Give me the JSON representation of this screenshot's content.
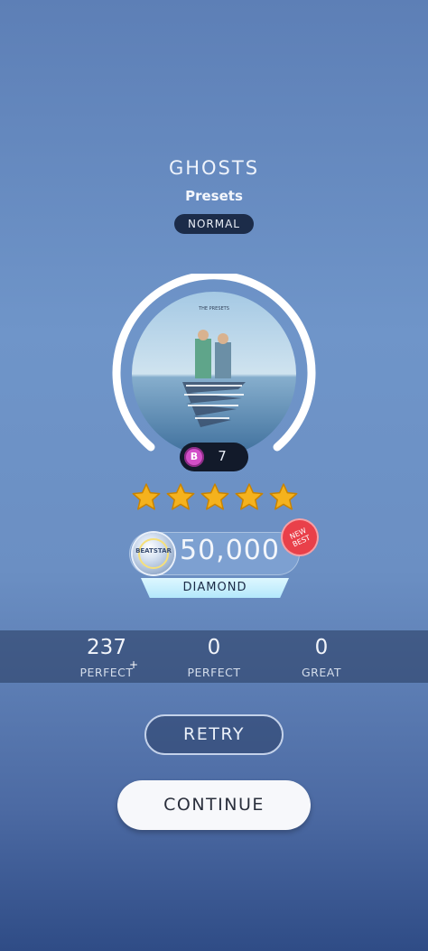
{
  "song": {
    "title": "GHOSTS",
    "artist": "Presets",
    "difficulty": "NORMAL"
  },
  "cover": {
    "caption": "THE PRESETS",
    "description": "album-cover"
  },
  "level": {
    "icon": "level-gem-icon",
    "value": "7"
  },
  "stars": {
    "count": 5,
    "max": 5
  },
  "score": {
    "value": "50,000",
    "grade": "DIAMOND",
    "badge_text": "BEATSTAR",
    "new_best": [
      "NEW",
      "BEST"
    ]
  },
  "stats": [
    {
      "value": "237",
      "label": "PERFECT",
      "sup": "+"
    },
    {
      "value": "0",
      "label": "PERFECT"
    },
    {
      "value": "0",
      "label": "GREAT"
    }
  ],
  "buttons": {
    "retry": "RETRY",
    "continue": "CONTINUE"
  },
  "colors": {
    "star": "#f5b21d",
    "new_best": "#e9404a",
    "grade_bar": "#c8eefc"
  }
}
